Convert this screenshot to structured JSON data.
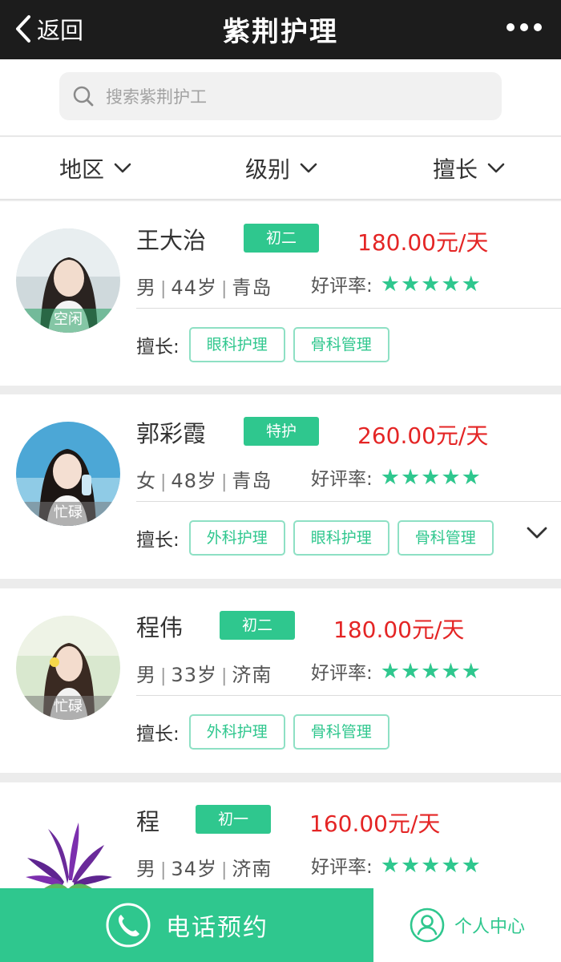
{
  "header": {
    "back_label": "返回",
    "title": "紫荆护理",
    "back_icon": "chevron-left-icon",
    "more_icon": "more-dots-icon"
  },
  "search": {
    "placeholder": "搜索紫荆护工",
    "icon": "search-icon"
  },
  "filters": [
    {
      "label": "地区",
      "icon": "chevron-down-icon"
    },
    {
      "label": "级别",
      "icon": "chevron-down-icon"
    },
    {
      "label": "擅长",
      "icon": "chevron-down-icon"
    }
  ],
  "caregivers": [
    {
      "name": "王大治",
      "level": "初二",
      "price": "180.00元/天",
      "gender": "男",
      "age": "44岁",
      "city": "青岛",
      "rating_label": "好评率:",
      "stars": "★★★★★",
      "rating_stars": 5,
      "status": "空闲",
      "skills_label": "擅长:",
      "skills": [
        "眼科护理",
        "骨科管理"
      ]
    },
    {
      "name": "郭彩霞",
      "level": "特护",
      "price": "260.00元/天",
      "gender": "女",
      "age": "48岁",
      "city": "青岛",
      "rating_label": "好评率:",
      "stars": "★★★★★",
      "rating_stars": 5,
      "status": "忙碌",
      "skills_label": "擅长:",
      "skills": [
        "外科护理",
        "眼科护理",
        "骨科管理"
      ]
    },
    {
      "name": "程伟",
      "level": "初二",
      "price": "180.00元/天",
      "gender": "男",
      "age": "33岁",
      "city": "济南",
      "rating_label": "好评率:",
      "stars": "★★★★★",
      "rating_stars": 5,
      "status": "忙碌",
      "skills_label": "擅长:",
      "skills": [
        "外科护理",
        "骨科管理"
      ]
    },
    {
      "name": "程",
      "level": "初一",
      "price": "160.00元/天",
      "gender": "男",
      "age": "34岁",
      "city": "济南",
      "rating_label": "好评率:",
      "stars": "★★★★★",
      "rating_stars": 5
    }
  ],
  "bottom": {
    "call_label": "电话预约",
    "call_icon": "phone-icon",
    "user_label": "个人中心",
    "user_icon": "user-icon"
  },
  "colors": {
    "accent": "#2fc78e",
    "price": "#e42525",
    "topbar": "#1c1c1c"
  }
}
